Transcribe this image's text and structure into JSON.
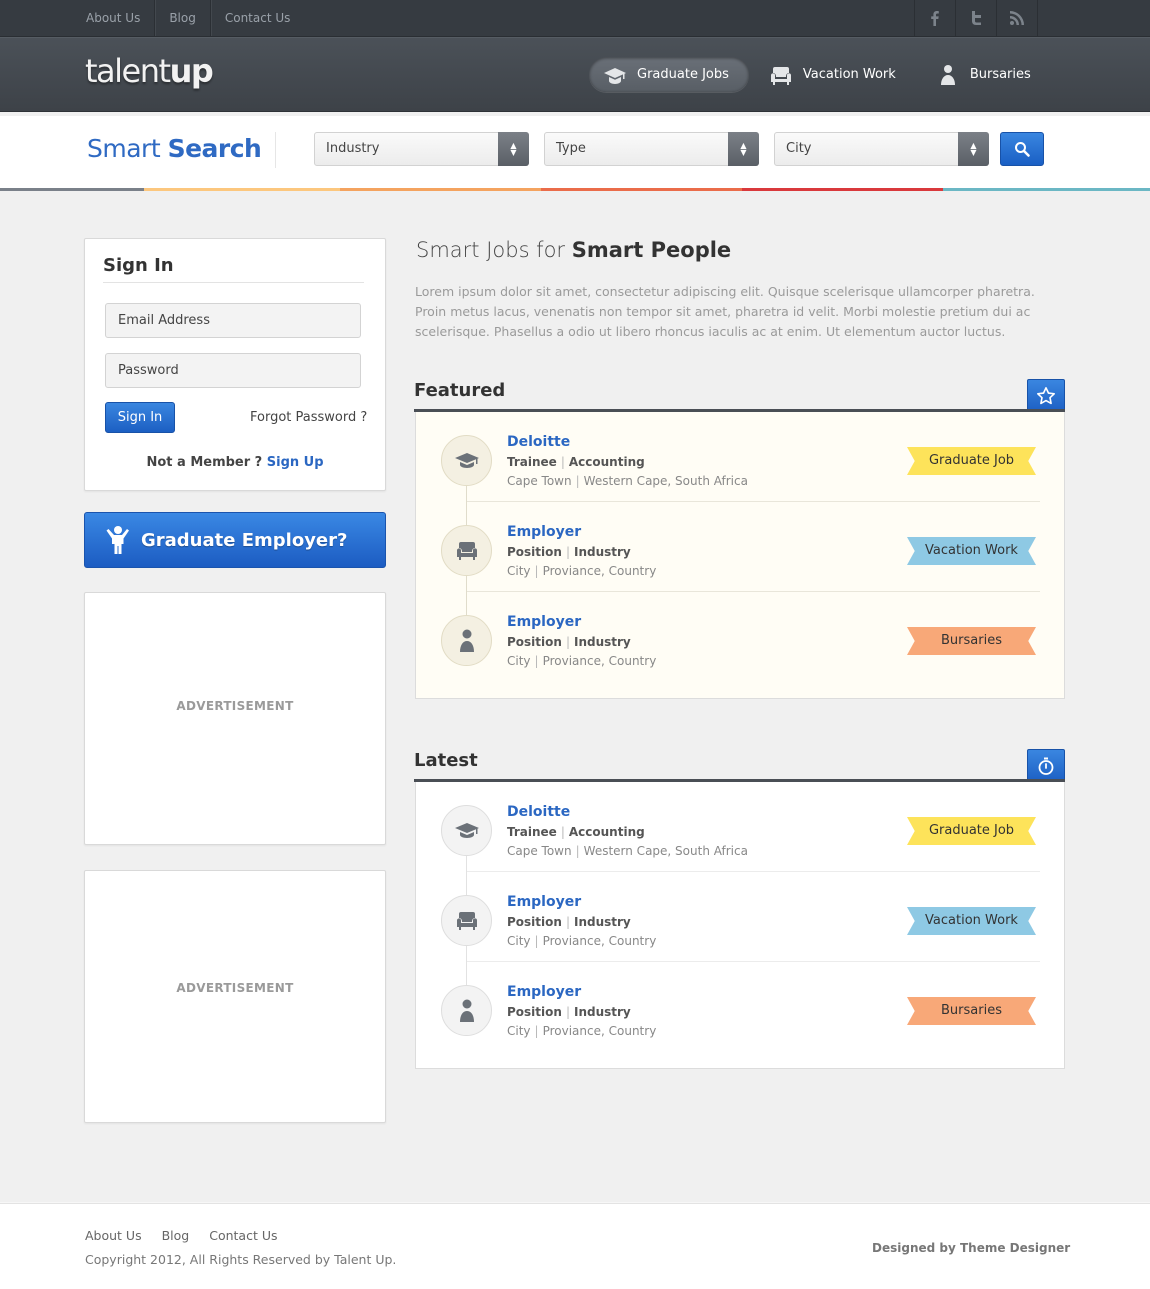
{
  "topnav": {
    "items": [
      {
        "label": "About Us"
      },
      {
        "label": "Blog"
      },
      {
        "label": "Contact Us"
      }
    ],
    "social": [
      "facebook-icon",
      "twitter-icon",
      "rss-icon"
    ]
  },
  "header": {
    "logo_light": "talent",
    "logo_bold": "up",
    "nav": [
      {
        "label": "Graduate Jobs",
        "icon": "mortarboard-icon",
        "active": true
      },
      {
        "label": "Vacation Work",
        "icon": "armchair-icon",
        "active": false
      },
      {
        "label": "Bursaries",
        "icon": "person-icon",
        "active": false
      }
    ]
  },
  "search": {
    "title_light": "Smart",
    "title_bold": "Search",
    "industry": "Industry",
    "type": "Type",
    "city": "City"
  },
  "signin": {
    "title": "Sign In",
    "email_placeholder": "Email Address",
    "password_placeholder": "Password",
    "button": "Sign In",
    "forgot": "Forgot Password ?",
    "not_member": "Not a Member ?",
    "signup": "Sign Up"
  },
  "graduate_employer": "Graduate Employer?",
  "ads": [
    "ADVERTISEMENT",
    "ADVERTISEMENT"
  ],
  "intro": {
    "title_light": "Smart Jobs for",
    "title_bold": "Smart People",
    "text": "Lorem ipsum dolor sit amet, consectetur adipiscing elit. Quisque scelerisque ullamcorper pharetra. Proin metus lacus, venenatis non tempor sit amet, pharetra id velit. Morbi molestie pretium dui ac scelerisque. Phasellus a odio ut libero rhoncus iaculis ac at enim. Ut elementum auctor luctus."
  },
  "featured": {
    "title": "Featured",
    "jobs": [
      {
        "employer": "Deloitte",
        "position": "Trainee",
        "industry": "Accounting",
        "city": "Cape Town",
        "region": "Western Cape, South Africa",
        "tag": "Graduate Job",
        "tag_color": "#fde35a"
      },
      {
        "employer": "Employer",
        "position": "Position",
        "industry": "Industry",
        "city": "City",
        "region": "Proviance, Country",
        "tag": "Vacation Work",
        "tag_color": "#8ec9e4"
      },
      {
        "employer": "Employer",
        "position": "Position",
        "industry": "Industry",
        "city": "City",
        "region": "Proviance, Country",
        "tag": "Bursaries",
        "tag_color": "#f8a878"
      }
    ]
  },
  "latest": {
    "title": "Latest",
    "jobs": [
      {
        "employer": "Deloitte",
        "position": "Trainee",
        "industry": "Accounting",
        "city": "Cape Town",
        "region": "Western Cape, South Africa",
        "tag": "Graduate Job",
        "tag_color": "#fde35a"
      },
      {
        "employer": "Employer",
        "position": "Position",
        "industry": "Industry",
        "city": "City",
        "region": "Proviance, Country",
        "tag": "Vacation Work",
        "tag_color": "#8ec9e4"
      },
      {
        "employer": "Employer",
        "position": "Position",
        "industry": "Industry",
        "city": "City",
        "region": "Proviance, Country",
        "tag": "Bursaries",
        "tag_color": "#f8a878"
      }
    ]
  },
  "footer": {
    "nav": [
      {
        "label": "About Us"
      },
      {
        "label": "Blog"
      },
      {
        "label": "Contact Us"
      }
    ],
    "copyright": "Copyright 2012, All Rights Reserved by Talent Up.",
    "designed_by": "Designed by Theme Designer"
  },
  "colors": {
    "accent": "#2b67c2",
    "stripe": [
      "#7a8089",
      "#fcc77e",
      "#f4a35f",
      "#ea6c4a",
      "#d9393c",
      "#6bb7c4"
    ]
  }
}
